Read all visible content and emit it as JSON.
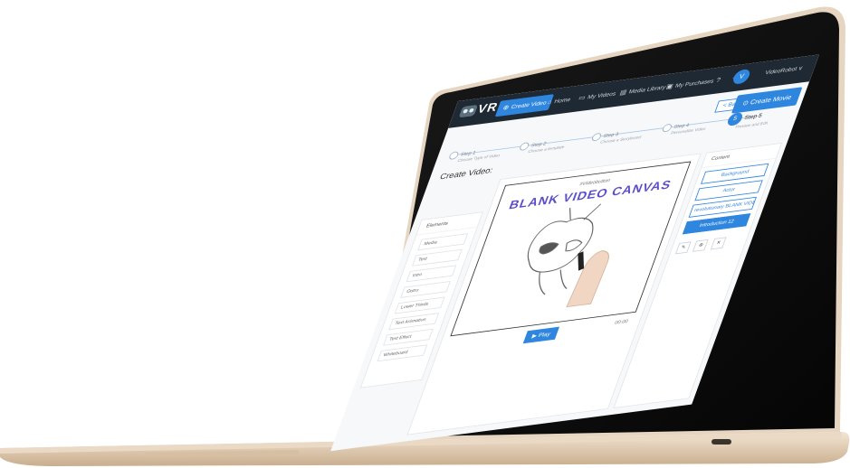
{
  "app": {
    "logo_text": "VR",
    "nav": [
      {
        "label": "Create Video",
        "icon": "create-video-icon"
      },
      {
        "label": "Home",
        "icon": "home-icon"
      },
      {
        "label": "My Videos",
        "icon": "my-videos-icon"
      },
      {
        "label": "Media Library",
        "icon": "media-library-icon"
      },
      {
        "label": "My Purchases",
        "icon": "my-purchases-icon"
      }
    ],
    "help_icon": "help-icon",
    "settings_icon": "settings-icon",
    "user": {
      "avatar_letter": "V",
      "name": "VideoRobot ∨"
    }
  },
  "toolbar": {
    "back_label": "< Back",
    "create_label": "Create Movie"
  },
  "page_title": "Create Video:",
  "steps": [
    {
      "label": "Step 1",
      "sub": "Choose Type of Video"
    },
    {
      "label": "Step 2",
      "sub": "Choose a template"
    },
    {
      "label": "Step 3",
      "sub": "Choose a Storyboard"
    },
    {
      "label": "Step 4",
      "sub": "Personalize Video"
    },
    {
      "label": "Step 5",
      "sub": "Preview and Edit",
      "number": "5"
    }
  ],
  "elements_panel": {
    "title": "Elements",
    "items": [
      "Media",
      "Text",
      "Intro",
      "Outro",
      "Lower Thirds",
      "Text Animation",
      "Text Effect",
      "Whiteboard"
    ]
  },
  "canvas": {
    "brand": "#Videobutton",
    "title": "BLANK VIDEO CANVAS",
    "play_label": "Play",
    "time": "00:00"
  },
  "content_panel": {
    "title": "Content",
    "items": [
      "Background",
      "Actor",
      "revolutionary BLANK VIDEO...",
      "Introduction 12"
    ],
    "tools": [
      "✎",
      "⊕",
      "✕"
    ]
  },
  "colors": {
    "accent": "#2f86de",
    "topbar": "#1f2933",
    "canvas_title": "#5b4fc9"
  }
}
